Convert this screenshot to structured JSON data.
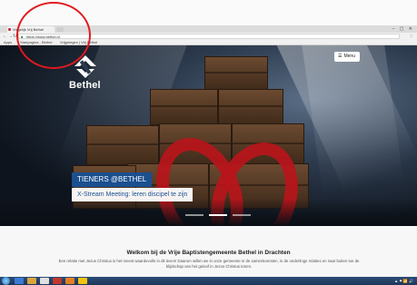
{
  "browser": {
    "tab_title": "Vrijgelijk Vrij Bethel",
    "url": "https://www.bethel.nl",
    "bookmarks": [
      "Apps",
      "Startpagina - Bethel",
      "Vrijgelegen | Vrij Bethel"
    ],
    "window_controls": "– ▢ ✕"
  },
  "site": {
    "logo_text": "Bethel",
    "menu_label": "Menu",
    "hero": {
      "tag": "TIENERS @BETHEL",
      "caption": "X-Stream Meeting: leren discipel te zijn",
      "slides_total": 3,
      "slide_active": 2
    },
    "welcome_title": "Welkom bij de Vrije Baptistengemeente Bethel in Drachten",
    "intro_text": "Een relatie met Jezus Christus is het meest waardevolle in dit leven! Daarom willen we in onze gemeente in de samenkomsten, in de onderlinge relaties en naar buiten toe de blijdschap van het geloof in Jezus Christus tonen."
  },
  "taskbar": {
    "tray_text": "▲ ⚑ 📶 🔊"
  },
  "colors": {
    "brand_blue": "#1b4f8f",
    "annotation_red": "#e0191e",
    "cross_red": "#b9151b"
  },
  "icons": [
    "back-arrow-icon",
    "forward-arrow-icon",
    "reload-icon",
    "lock-icon",
    "star-icon",
    "menu-bars-icon",
    "windows-start-icon"
  ]
}
